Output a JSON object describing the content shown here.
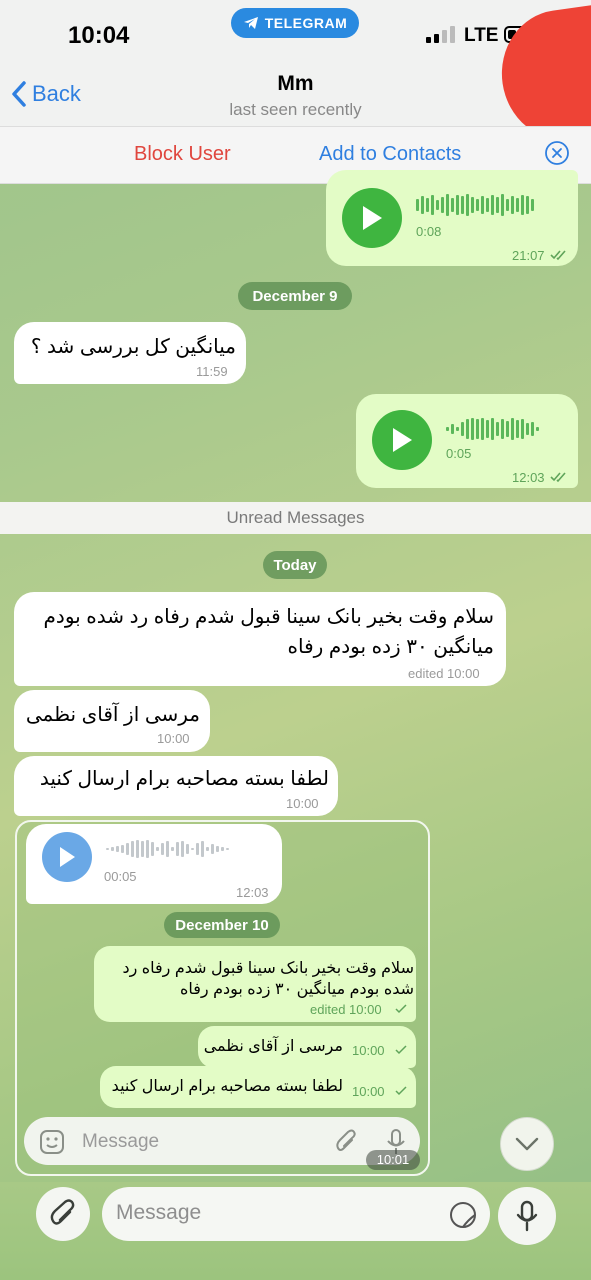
{
  "status_bar": {
    "time": "10:04",
    "app_badge": "TELEGRAM",
    "network": "LTE"
  },
  "header": {
    "back_label": "Back",
    "title": "Mm",
    "subtitle": "last seen recently"
  },
  "actions": {
    "block_user": "Block User",
    "add_to_contacts": "Add to Contacts"
  },
  "messages_top": [
    {
      "type": "voice",
      "direction": "out",
      "duration": "0:08",
      "time": "21:07"
    },
    {
      "type": "date",
      "label": "December 9"
    },
    {
      "type": "text",
      "direction": "in",
      "text": "میانگین کل بررسی شد ؟",
      "time": "11:59"
    },
    {
      "type": "voice",
      "direction": "out",
      "duration": "0:05",
      "time": "12:03"
    }
  ],
  "unread_label": "Unread Messages",
  "today_label": "Today",
  "messages_today": [
    {
      "direction": "in",
      "lines": [
        "سلام وقت بخیر بانک سینا قبول شدم رفاه رد شده بودم",
        "میانگین ۳۰ زده بودم رفاه"
      ],
      "time": "edited 10:00"
    },
    {
      "direction": "in",
      "text": "مرسی از آقای نظمی",
      "time": "10:00"
    },
    {
      "direction": "in",
      "text": "لطفا بسته مصاحبه برام ارسال کنید",
      "time": "10:00"
    }
  ],
  "forwarded_screenshot": {
    "voice": {
      "duration": "00:05",
      "time": "12:03"
    },
    "date_label": "December 10",
    "messages": [
      {
        "lines": [
          "سلام وقت بخیر بانک سینا قبول شدم رفاه رد",
          "شده بودم میانگین ۳۰ زده بودم رفاه"
        ],
        "time": "edited 10:00"
      },
      {
        "text": "مرسی از آقای نظمی",
        "time": "10:00"
      },
      {
        "text": "لطفا بسته مصاحبه برام ارسال کنید",
        "time": "10:00"
      }
    ],
    "input_placeholder": "Message",
    "overlay_time": "10:01"
  },
  "composer": {
    "placeholder": "Message"
  },
  "colors": {
    "accent": "#2f7fe0",
    "danger": "#e0463e",
    "outgoing_bubble": "#e3fcc6",
    "play_green": "#3fb540",
    "play_blue": "#6aa8e6"
  }
}
